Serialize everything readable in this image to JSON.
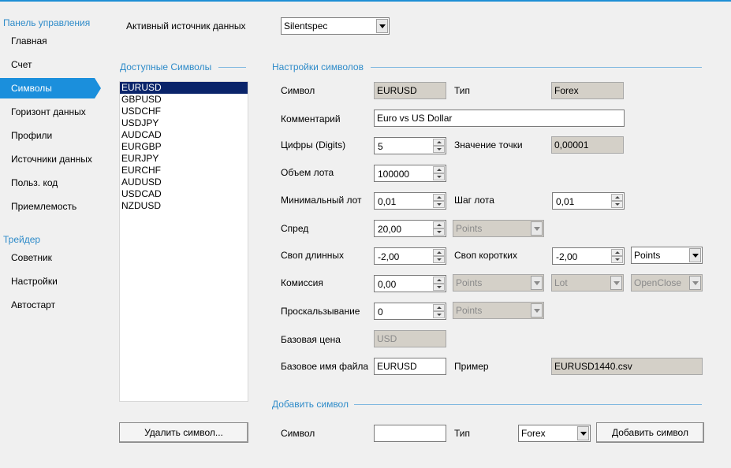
{
  "sidebar": {
    "panel_title": "Панель управления",
    "items": [
      {
        "label": "Главная"
      },
      {
        "label": "Счет"
      },
      {
        "label": "Символы"
      },
      {
        "label": "Горизонт данных"
      },
      {
        "label": "Профили"
      },
      {
        "label": "Источники данных"
      },
      {
        "label": "Польз. код"
      },
      {
        "label": "Приемлемость"
      }
    ],
    "trader_title": "Трейдер",
    "trader_items": [
      {
        "label": "Советник"
      },
      {
        "label": "Настройки"
      },
      {
        "label": "Автостарт"
      }
    ],
    "active_item": "Символы"
  },
  "source": {
    "label": "Активный источник данных",
    "value": "Silentspec"
  },
  "symbols_list": {
    "title": "Доступные Символы",
    "items": [
      "EURUSD",
      "GBPUSD",
      "USDCHF",
      "USDJPY",
      "AUDCAD",
      "EURGBP",
      "EURJPY",
      "EURCHF",
      "AUDUSD",
      "USDCAD",
      "NZDUSD"
    ],
    "selected": "EURUSD",
    "delete_button": "Удалить символ..."
  },
  "settings": {
    "title": "Настройки символов",
    "symbol_label": "Символ",
    "symbol_value": "EURUSD",
    "type_label": "Тип",
    "type_value": "Forex",
    "comment_label": "Комментарий",
    "comment_value": "Euro vs US Dollar",
    "digits_label": "Цифры (Digits)",
    "digits_value": "5",
    "point_label": "Значение точки",
    "point_value": "0,00001",
    "lot_size_label": "Объем лота",
    "lot_size_value": "100000",
    "min_lot_label": "Минимальный лот",
    "min_lot_value": "0,01",
    "lot_step_label": "Шаг лота",
    "lot_step_value": "0,01",
    "spread_label": "Спред",
    "spread_value": "20,00",
    "spread_unit": "Points",
    "swap_long_label": "Своп длинных",
    "swap_long_value": "-2,00",
    "swap_short_label": "Своп коротких",
    "swap_short_value": "-2,00",
    "swap_unit": "Points",
    "commission_label": "Комиссия",
    "commission_value": "0,00",
    "commission_unit": "Points",
    "commission_per": "Lot",
    "commission_mode": "OpenClose",
    "slippage_label": "Проскальзывание",
    "slippage_value": "0",
    "slippage_unit": "Points",
    "base_price_label": "Базовая цена",
    "base_price_value": "USD",
    "base_file_label": "Базовое имя файла",
    "base_file_value": "EURUSD",
    "example_label": "Пример",
    "example_value": "EURUSD1440.csv"
  },
  "add_symbol": {
    "title": "Добавить символ",
    "symbol_label": "Символ",
    "symbol_value": "",
    "type_label": "Тип",
    "type_value": "Forex",
    "add_button": "Добавить символ"
  },
  "colors": {
    "accent": "#1b8fdc",
    "section_title": "#2e8bc9",
    "panel_bg": "#f0f0f0",
    "selection": "#0a246a"
  }
}
